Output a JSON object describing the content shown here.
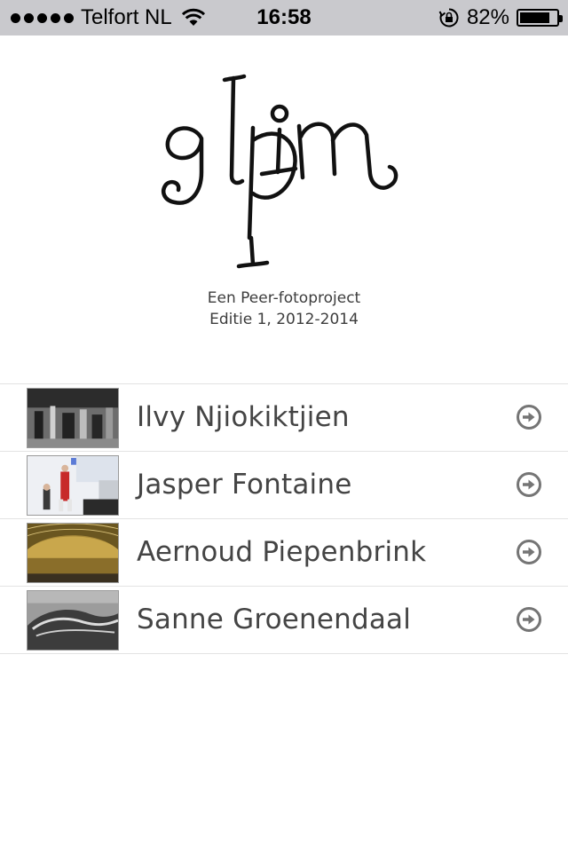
{
  "status_bar": {
    "carrier": "Telfort NL",
    "time": "16:58",
    "battery_percent": "82%",
    "battery_level": 0.82
  },
  "header": {
    "logo_text": "glim",
    "subtitle_line1": "Een Peer-fotoproject",
    "subtitle_line2": "Editie 1, 2012-2014"
  },
  "photographers": [
    {
      "name": "Ilvy Njiokiktjien"
    },
    {
      "name": "Jasper Fontaine"
    },
    {
      "name": "Aernoud Piepenbrink"
    },
    {
      "name": "Sanne Groenendaal"
    }
  ]
}
